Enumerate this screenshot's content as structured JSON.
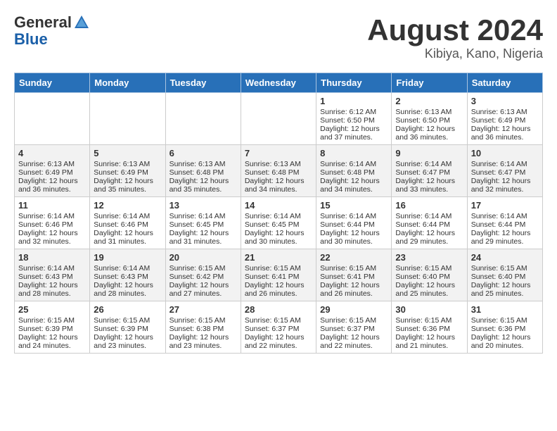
{
  "logo": {
    "general": "General",
    "blue": "Blue"
  },
  "title": "August 2024",
  "location": "Kibiya, Kano, Nigeria",
  "days_of_week": [
    "Sunday",
    "Monday",
    "Tuesday",
    "Wednesday",
    "Thursday",
    "Friday",
    "Saturday"
  ],
  "weeks": [
    [
      {
        "day": "",
        "content": ""
      },
      {
        "day": "",
        "content": ""
      },
      {
        "day": "",
        "content": ""
      },
      {
        "day": "",
        "content": ""
      },
      {
        "day": "1",
        "content": "Sunrise: 6:12 AM\nSunset: 6:50 PM\nDaylight: 12 hours and 37 minutes."
      },
      {
        "day": "2",
        "content": "Sunrise: 6:13 AM\nSunset: 6:50 PM\nDaylight: 12 hours and 36 minutes."
      },
      {
        "day": "3",
        "content": "Sunrise: 6:13 AM\nSunset: 6:49 PM\nDaylight: 12 hours and 36 minutes."
      }
    ],
    [
      {
        "day": "4",
        "content": "Sunrise: 6:13 AM\nSunset: 6:49 PM\nDaylight: 12 hours and 36 minutes."
      },
      {
        "day": "5",
        "content": "Sunrise: 6:13 AM\nSunset: 6:49 PM\nDaylight: 12 hours and 35 minutes."
      },
      {
        "day": "6",
        "content": "Sunrise: 6:13 AM\nSunset: 6:48 PM\nDaylight: 12 hours and 35 minutes."
      },
      {
        "day": "7",
        "content": "Sunrise: 6:13 AM\nSunset: 6:48 PM\nDaylight: 12 hours and 34 minutes."
      },
      {
        "day": "8",
        "content": "Sunrise: 6:14 AM\nSunset: 6:48 PM\nDaylight: 12 hours and 34 minutes."
      },
      {
        "day": "9",
        "content": "Sunrise: 6:14 AM\nSunset: 6:47 PM\nDaylight: 12 hours and 33 minutes."
      },
      {
        "day": "10",
        "content": "Sunrise: 6:14 AM\nSunset: 6:47 PM\nDaylight: 12 hours and 32 minutes."
      }
    ],
    [
      {
        "day": "11",
        "content": "Sunrise: 6:14 AM\nSunset: 6:46 PM\nDaylight: 12 hours and 32 minutes."
      },
      {
        "day": "12",
        "content": "Sunrise: 6:14 AM\nSunset: 6:46 PM\nDaylight: 12 hours and 31 minutes."
      },
      {
        "day": "13",
        "content": "Sunrise: 6:14 AM\nSunset: 6:45 PM\nDaylight: 12 hours and 31 minutes."
      },
      {
        "day": "14",
        "content": "Sunrise: 6:14 AM\nSunset: 6:45 PM\nDaylight: 12 hours and 30 minutes."
      },
      {
        "day": "15",
        "content": "Sunrise: 6:14 AM\nSunset: 6:44 PM\nDaylight: 12 hours and 30 minutes."
      },
      {
        "day": "16",
        "content": "Sunrise: 6:14 AM\nSunset: 6:44 PM\nDaylight: 12 hours and 29 minutes."
      },
      {
        "day": "17",
        "content": "Sunrise: 6:14 AM\nSunset: 6:44 PM\nDaylight: 12 hours and 29 minutes."
      }
    ],
    [
      {
        "day": "18",
        "content": "Sunrise: 6:14 AM\nSunset: 6:43 PM\nDaylight: 12 hours and 28 minutes."
      },
      {
        "day": "19",
        "content": "Sunrise: 6:14 AM\nSunset: 6:43 PM\nDaylight: 12 hours and 28 minutes."
      },
      {
        "day": "20",
        "content": "Sunrise: 6:15 AM\nSunset: 6:42 PM\nDaylight: 12 hours and 27 minutes."
      },
      {
        "day": "21",
        "content": "Sunrise: 6:15 AM\nSunset: 6:41 PM\nDaylight: 12 hours and 26 minutes."
      },
      {
        "day": "22",
        "content": "Sunrise: 6:15 AM\nSunset: 6:41 PM\nDaylight: 12 hours and 26 minutes."
      },
      {
        "day": "23",
        "content": "Sunrise: 6:15 AM\nSunset: 6:40 PM\nDaylight: 12 hours and 25 minutes."
      },
      {
        "day": "24",
        "content": "Sunrise: 6:15 AM\nSunset: 6:40 PM\nDaylight: 12 hours and 25 minutes."
      }
    ],
    [
      {
        "day": "25",
        "content": "Sunrise: 6:15 AM\nSunset: 6:39 PM\nDaylight: 12 hours and 24 minutes."
      },
      {
        "day": "26",
        "content": "Sunrise: 6:15 AM\nSunset: 6:39 PM\nDaylight: 12 hours and 23 minutes."
      },
      {
        "day": "27",
        "content": "Sunrise: 6:15 AM\nSunset: 6:38 PM\nDaylight: 12 hours and 23 minutes."
      },
      {
        "day": "28",
        "content": "Sunrise: 6:15 AM\nSunset: 6:37 PM\nDaylight: 12 hours and 22 minutes."
      },
      {
        "day": "29",
        "content": "Sunrise: 6:15 AM\nSunset: 6:37 PM\nDaylight: 12 hours and 22 minutes."
      },
      {
        "day": "30",
        "content": "Sunrise: 6:15 AM\nSunset: 6:36 PM\nDaylight: 12 hours and 21 minutes."
      },
      {
        "day": "31",
        "content": "Sunrise: 6:15 AM\nSunset: 6:36 PM\nDaylight: 12 hours and 20 minutes."
      }
    ]
  ]
}
